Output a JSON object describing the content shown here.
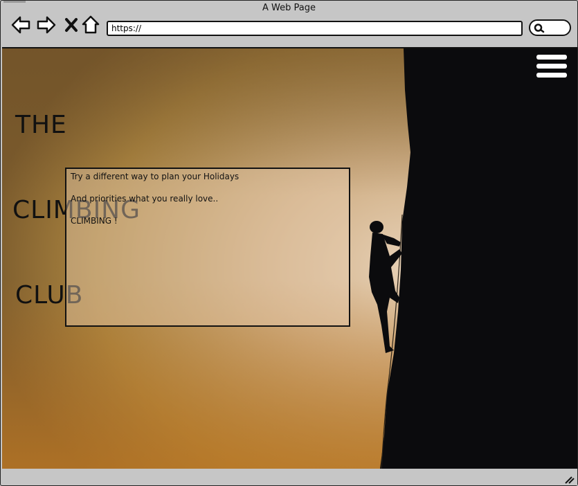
{
  "window": {
    "title": "A Web Page"
  },
  "toolbar": {
    "back_icon": "back-arrow-icon",
    "forward_icon": "forward-arrow-icon",
    "close_icon": "close-x-icon",
    "home_icon": "home-icon",
    "url": "https://",
    "search_icon": "search-icon"
  },
  "page": {
    "logo_line1": "THE",
    "logo_line2": "CLIMBING",
    "logo_line3": "CLUB",
    "menu_icon": "hamburger-menu-icon",
    "intro_line1": "Try a different way to plan your Holidays",
    "intro_line2": "And priorities what you really love..",
    "intro_line3": "CLIMBING !"
  },
  "colors": {
    "sky_top": "#8a6a3c",
    "sky_glow": "#e6cdb0",
    "sky_bottom": "#b87a2a",
    "rock": "#0b0b0d"
  }
}
